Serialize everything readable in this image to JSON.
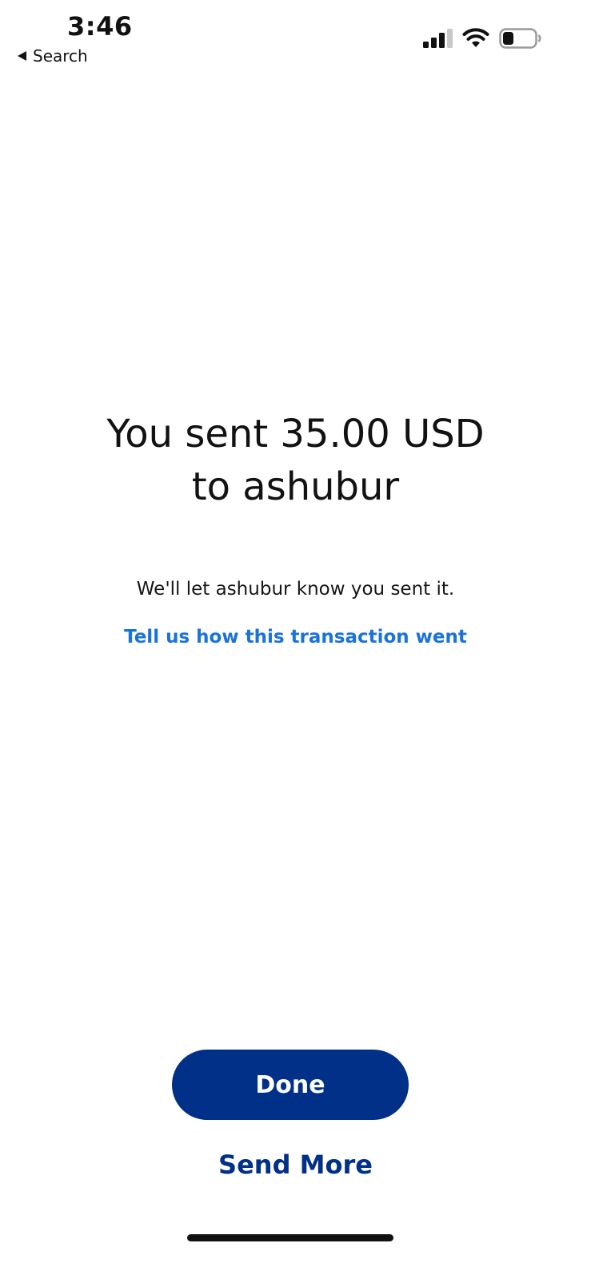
{
  "status_bar": {
    "time": "3:46",
    "back_label": "Search",
    "icons": [
      "signal-icon",
      "wifi-icon",
      "battery-icon"
    ],
    "battery_level": 0.35
  },
  "main": {
    "headline_line1": "You sent 35.00 USD",
    "headline_line2": "to ashubur",
    "subtext": "We'll let ashubur know you sent it.",
    "feedback_link": "Tell us how this transaction went"
  },
  "actions": {
    "done_label": "Done",
    "send_more_label": "Send More"
  },
  "colors": {
    "primary": "#003087",
    "link": "#1a73d9",
    "background": "#ffffff"
  }
}
